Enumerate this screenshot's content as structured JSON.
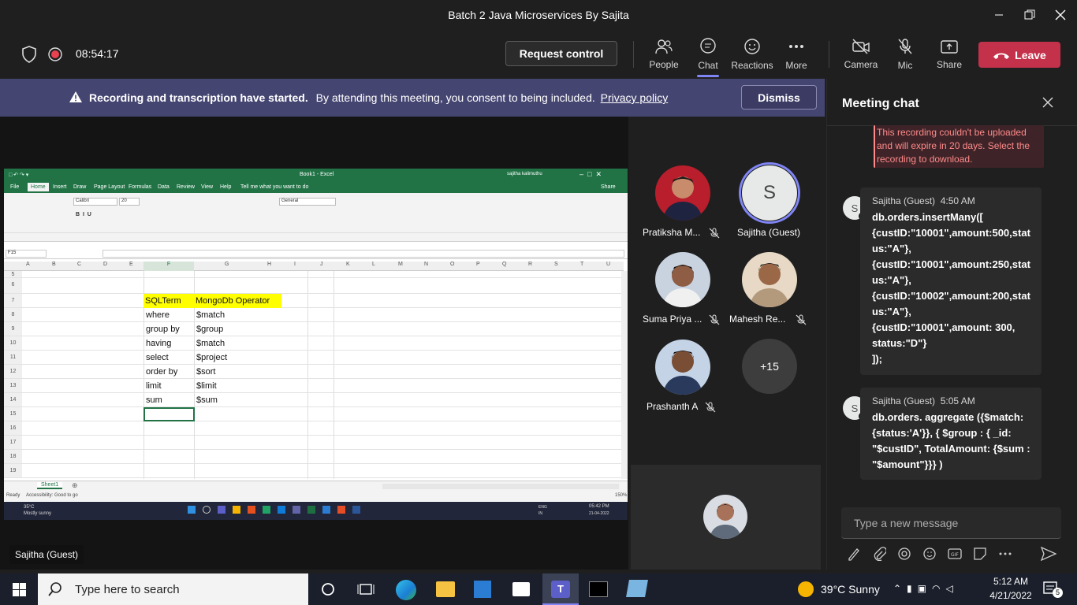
{
  "window": {
    "title": "Batch 2 Java Microservices By Sajita"
  },
  "meeting": {
    "timer": "08:54:17",
    "request_control": "Request control",
    "buttons": {
      "people": "People",
      "chat": "Chat",
      "reactions": "Reactions",
      "more": "More",
      "camera": "Camera",
      "mic": "Mic",
      "share": "Share"
    },
    "leave": "Leave"
  },
  "banner": {
    "bold": "Recording and transcription have started.",
    "text": "By attending this meeting, you consent to being included.",
    "link": "Privacy policy",
    "dismiss": "Dismiss"
  },
  "excel": {
    "title": "Book1 - Excel",
    "user": "sajitha kalimuthu",
    "name_box": "F15",
    "tabs": [
      "File",
      "Home",
      "Insert",
      "Draw",
      "Page Layout",
      "Formulas",
      "Data",
      "Review",
      "View",
      "Help",
      "Tell me what you want to do"
    ],
    "share": "Share",
    "columns": [
      "A",
      "B",
      "C",
      "D",
      "E",
      "F",
      "G",
      "H",
      "I",
      "J",
      "K",
      "L",
      "M",
      "N",
      "O",
      "P",
      "Q",
      "R",
      "S",
      "T",
      "U"
    ],
    "rows": [
      {
        "n": "5",
        "f": "",
        "g": ""
      },
      {
        "n": "6",
        "f": "",
        "g": ""
      },
      {
        "n": "7",
        "f": "SQLTerm",
        "g": "MongoDb Operator"
      },
      {
        "n": "8",
        "f": "where",
        "g": "$match"
      },
      {
        "n": "9",
        "f": "group by",
        "g": "$group"
      },
      {
        "n": "10",
        "f": "having",
        "g": "$match"
      },
      {
        "n": "11",
        "f": "select",
        "g": "$project"
      },
      {
        "n": "12",
        "f": "order by",
        "g": "$sort"
      },
      {
        "n": "13",
        "f": "limit",
        "g": "$limit"
      },
      {
        "n": "14",
        "f": "sum",
        "g": "$sum"
      },
      {
        "n": "15",
        "f": "",
        "g": ""
      },
      {
        "n": "16",
        "f": "",
        "g": ""
      },
      {
        "n": "17",
        "f": "",
        "g": ""
      },
      {
        "n": "18",
        "f": "",
        "g": ""
      },
      {
        "n": "19",
        "f": "",
        "g": ""
      }
    ],
    "sheet_tab": "Sheet1",
    "status": "Ready",
    "accessibility": "Accessibility: Good to go",
    "zoom": "150%",
    "weather": "35°C",
    "weather_desc": "Mostly sunny",
    "time": "05:42 PM",
    "date": "21-04-2022",
    "lang": "ENG IN",
    "highlight_color": "#ffff00",
    "font_name": "Calibri",
    "font_size": "20",
    "number_format": "General"
  },
  "presenter_label": "Sajitha (Guest)",
  "participants": [
    {
      "name": "Pratiksha M...",
      "muted": true
    },
    {
      "name": "Sajitha (Guest)",
      "initial": "S",
      "muted": false
    },
    {
      "name": "Suma Priya ...",
      "muted": true
    },
    {
      "name": "Mahesh Re...",
      "muted": true
    },
    {
      "name": "Prashanth A",
      "muted": true
    },
    {
      "name": "+15"
    }
  ],
  "chat": {
    "title": "Meeting chat",
    "alert": "This recording couldn't be uploaded and will expire in 20 days. Select the recording to download.",
    "messages": [
      {
        "sender": "Sajitha (Guest)",
        "time": "4:50 AM",
        "initial": "S",
        "text": "db.orders.insertMany([\n{custID:\"10001\",amount:500,stat\nus:\"A\"},\n{custID:\"10001\",amount:250,stat\nus:\"A\"},\n{custID:\"10002\",amount:200,stat\nus:\"A\"},\n{custID:\"10001\",amount: 300,\nstatus:\"D\"}\n]);"
      },
      {
        "sender": "Sajitha (Guest)",
        "time": "5:05 AM",
        "initial": "S",
        "text": "db.orders. aggregate ({$match:\n{status:'A'}},    {  $group : { _id:\n\"$custID\", TotalAmount: {$sum :\n\"$amount\"}}} )"
      }
    ],
    "placeholder": "Type a new message"
  },
  "taskbar": {
    "search": "Type here to search",
    "weather": "39°C  Sunny",
    "time": "5:12 AM",
    "date": "4/21/2022",
    "notifications": "5"
  },
  "colors": {
    "leave": "#c4314b",
    "banner": "#454572",
    "accent": "#7f85f5",
    "excel": "#217346",
    "alert": "#ff8a8a"
  }
}
